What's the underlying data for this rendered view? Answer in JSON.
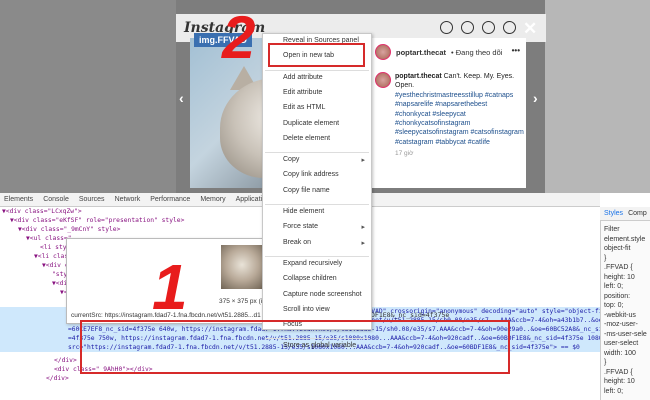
{
  "instagram": {
    "logo": "Instagram",
    "img_tag": "img.FFVAD",
    "close_glyph": "✕",
    "nav_icons": [
      "home-icon",
      "messenger-icon",
      "compass-icon",
      "heart-icon"
    ],
    "post": {
      "username": "poptart.thecat",
      "follow_text": "• Đang theo dõi",
      "caption_user": "poptart.thecat",
      "caption_text": "Can't. Keep. My. Eyes. Open.",
      "hashtags": [
        "#yesthechristmastreesstillup #catnaps",
        "#napsarelife #napsarethebest",
        "#chonkycat #sleepycat",
        "#chonkycatsofinstagram",
        "#sleepycatsofinstagram #catsofinstagram",
        "#catstagram #tabbycat #catlife"
      ],
      "time": "17 giờ"
    }
  },
  "annotations": {
    "step1": "1",
    "step2": "2"
  },
  "context_menu": {
    "items": [
      {
        "label": "Reveal in Sources panel",
        "arrow": false
      },
      {
        "label": "Open in new tab",
        "arrow": false
      },
      {
        "sep": true
      },
      {
        "label": "Add attribute",
        "arrow": false
      },
      {
        "label": "Edit attribute",
        "arrow": false
      },
      {
        "label": "Edit as HTML",
        "arrow": false
      },
      {
        "label": "Duplicate element",
        "arrow": false
      },
      {
        "label": "Delete element",
        "arrow": false
      },
      {
        "sep": true
      },
      {
        "label": "Copy",
        "arrow": true
      },
      {
        "label": "Copy link address",
        "arrow": false
      },
      {
        "label": "Copy file name",
        "arrow": false
      },
      {
        "sep": true
      },
      {
        "label": "Hide element",
        "arrow": false
      },
      {
        "label": "Force state",
        "arrow": true
      },
      {
        "label": "Break on",
        "arrow": true
      },
      {
        "sep": true
      },
      {
        "label": "Expand recursively",
        "arrow": false
      },
      {
        "label": "Collapse children",
        "arrow": false
      },
      {
        "label": "Capture node screenshot",
        "arrow": false
      },
      {
        "label": "Scroll into view",
        "arrow": false
      },
      {
        "label": "Focus",
        "arrow": false
      },
      {
        "sep": true
      },
      {
        "label": "Store as global variable",
        "arrow": false
      }
    ]
  },
  "devtools": {
    "tabs": [
      "Elements",
      "Console",
      "Sources",
      "Network",
      "Performance",
      "Memory",
      "Application"
    ],
    "side_tabs": [
      "Styles",
      "Comp"
    ],
    "side_lines": [
      "Filter",
      "element.style",
      "object-fit",
      "}",
      ".FFVAD {",
      "height: 10",
      "left: 0;",
      "position:",
      "top: 0;",
      "-webkit-us",
      "-moz-user-",
      "-ms-user-sele",
      "user-select",
      "width: 100",
      "}",
      ".FFVAD {",
      "height: 10",
      "left: 0;"
    ],
    "code_lines": [
      "▼<div class=\"LCxqZw\">",
      "  ▼<div class=\"eKfSF\" role=\"presentation\" style>",
      "    ▼<div class=\"_9mCnY\" style>",
      "      ▼<ul class=\"",
      "         <li sty",
      "       ▼<li class",
      "         ▼<div cl",
      "           \"style",
      "           ▼<div",
      "              ▼<d",
      "                 ...",
      "  <img alt=\"Image by Poptart on April 21, 2021. May be an image of cat.\" class=\"FFVAD\" crossorigin=\"anonymous\" decoding=\"auto\" style=\"object-fi",
      "     cover;\" sizes=\"375.3875122070312px\" srcset=\"https://instagram.fdad7-1.fna.fbcdn.net/v/t51.2885-15/sh0.08/e35/s7...AAA&ccb=7-4&oh=a43b1b7..&oe",
      "     =60CE7EF8_nc_sid=4f375e 640w, https://instagram.fdad7-1.fna.fbcdn.net/v/t51.2885-15/sh0.08/e35/s7.AAA&ccb=7-4&oh=90e29a0..&oe=60BC52A8&_nc_sid",
      "     =4f375e 750w, https://instagram.fdad7-1.fna.fbcdn.net/v/t51.2885-15/e35/s1080x1080...AAA&ccb=7-4&oh=920cadf..&oe=60BDF1E8&_nc_sid=4f375e 1080w\"",
      "     src=\"https://instagram.fdad7-1.fna.fbcdn.net/v/t51.2885-15/e35/s1080x1080...AAA&ccb=7-4&oh=920cadf..&oe=60BDF1E8&_nc_sid=4f375e\"> == $0",
      "     </div>",
      "   <div class=\"_9AhH0\"></div>",
      "   </div>"
    ]
  },
  "preview": {
    "dims": "375 × 375 px (intrinsic: 1",
    "current_src": "currentSrc: https://instagram.fdad7-1.fna.fbcdn.net/v/t51.2885...d1",
    "url_tail": "DF1E8&_nc_sid=4f375e"
  }
}
